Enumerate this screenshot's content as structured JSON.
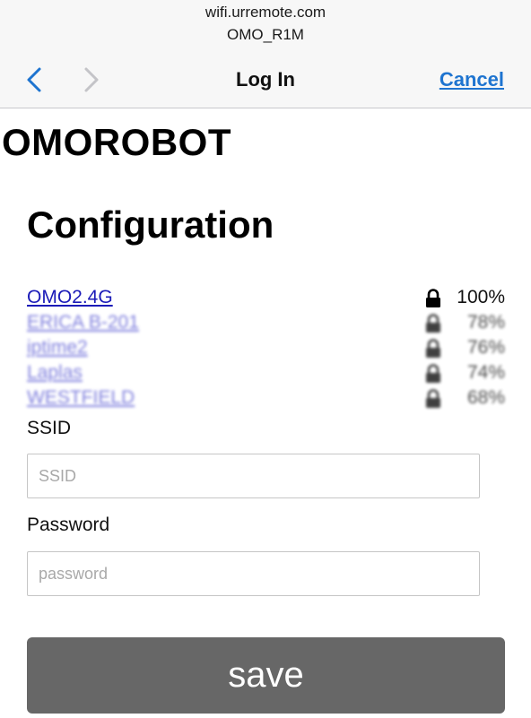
{
  "browser": {
    "url": "wifi.urremote.com",
    "page_subtitle": "OMO_R1M",
    "nav_title": "Log In",
    "cancel_label": "Cancel",
    "icons": {
      "back": "chevron-left-icon",
      "forward": "chevron-right-icon"
    },
    "accent_color": "#1e74d0"
  },
  "page": {
    "brand": "OMOROBOT",
    "heading": "Configuration"
  },
  "networks": [
    {
      "ssid": "OMO2.4G",
      "signal": "100%",
      "secured": true,
      "obscured": false
    },
    {
      "ssid": "ERICA B-201",
      "signal": "78%",
      "secured": true,
      "obscured": true
    },
    {
      "ssid": "iptime2",
      "signal": "76%",
      "secured": true,
      "obscured": true
    },
    {
      "ssid": "Laplas",
      "signal": "74%",
      "secured": true,
      "obscured": true
    },
    {
      "ssid": "WESTFIELD",
      "signal": "68%",
      "secured": true,
      "obscured": true
    }
  ],
  "form": {
    "ssid_label": "SSID",
    "ssid_placeholder": "SSID",
    "password_label": "Password",
    "password_placeholder": "password",
    "save_label": "save",
    "save_color": "#676767"
  }
}
